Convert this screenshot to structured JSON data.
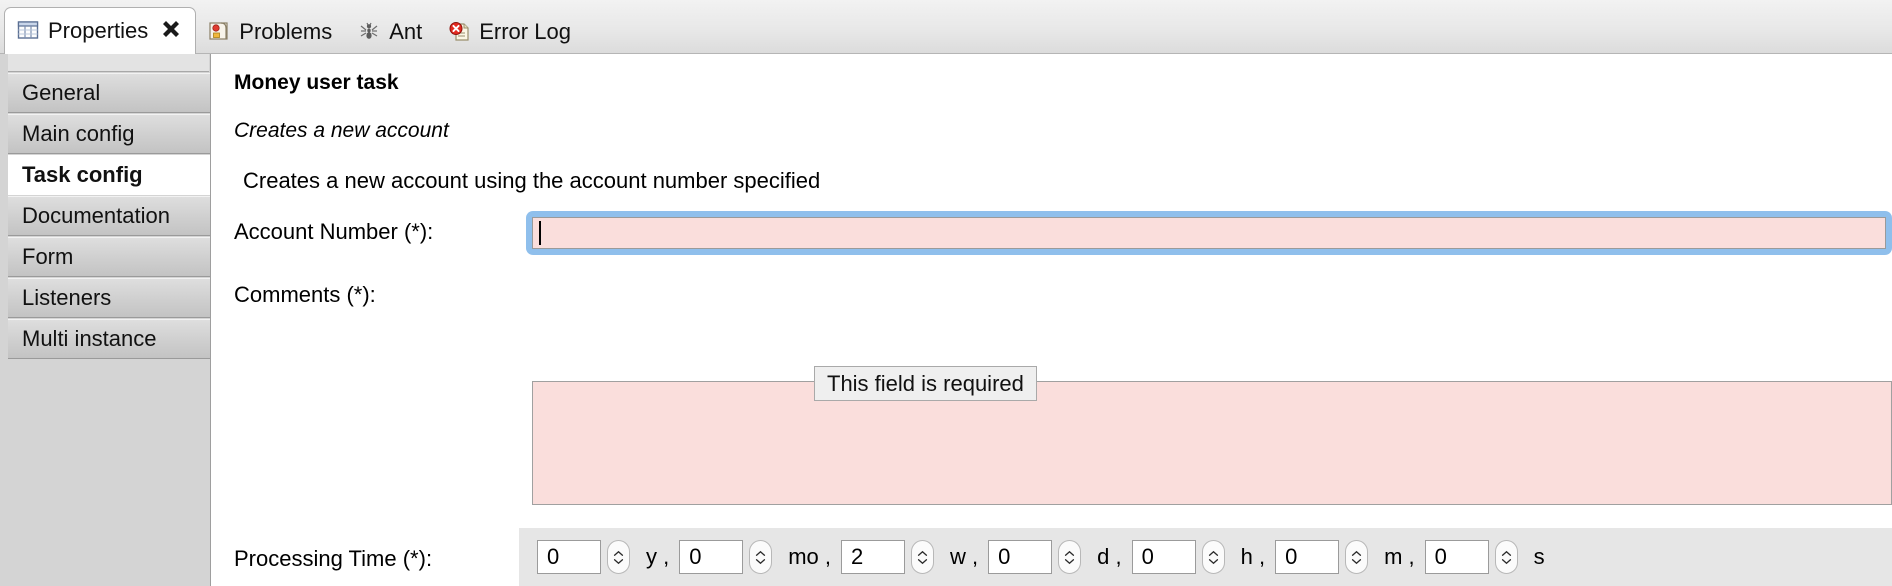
{
  "tabbar": {
    "tabs": [
      {
        "label": "Properties",
        "icon": "properties-table-icon",
        "active": true,
        "closable": true,
        "close_glyph": "✖"
      },
      {
        "label": "Problems",
        "icon": "problems-icon",
        "active": false,
        "closable": false
      },
      {
        "label": "Ant",
        "icon": "ant-icon",
        "active": false,
        "closable": false
      },
      {
        "label": "Error Log",
        "icon": "error-log-icon",
        "active": false,
        "closable": false
      }
    ]
  },
  "sidebar": {
    "items": [
      {
        "label": "General",
        "selected": false
      },
      {
        "label": "Main config",
        "selected": false
      },
      {
        "label": "Task config",
        "selected": true
      },
      {
        "label": "Documentation",
        "selected": false
      },
      {
        "label": "Form",
        "selected": false
      },
      {
        "label": "Listeners",
        "selected": false
      },
      {
        "label": "Multi instance",
        "selected": false
      }
    ]
  },
  "main": {
    "title": "Money user task",
    "subtitle": "Creates a new account",
    "description": "Creates a new account using the account number specified",
    "fields": {
      "account_number": {
        "label": "Account Number (*):",
        "value": "",
        "state": "focused-invalid"
      },
      "comments": {
        "label": "Comments (*):",
        "value": "",
        "state": "invalid"
      },
      "processing_time": {
        "label": "Processing Time (*):",
        "units": [
          {
            "value": "0",
            "unit": "y ,"
          },
          {
            "value": "0",
            "unit": "mo ,"
          },
          {
            "value": "2",
            "unit": "w ,"
          },
          {
            "value": "0",
            "unit": "d ,"
          },
          {
            "value": "0",
            "unit": "h ,"
          },
          {
            "value": "0",
            "unit": "m ,"
          },
          {
            "value": "0",
            "unit": "s"
          }
        ]
      }
    }
  },
  "tooltip": {
    "text": "This field is required"
  },
  "colors": {
    "focus_ring": "#8fbfec",
    "error_field_bg": "#fadedc",
    "panel_bg": "#e6e6e6",
    "sidebar_bg": "#d4d4d4"
  }
}
